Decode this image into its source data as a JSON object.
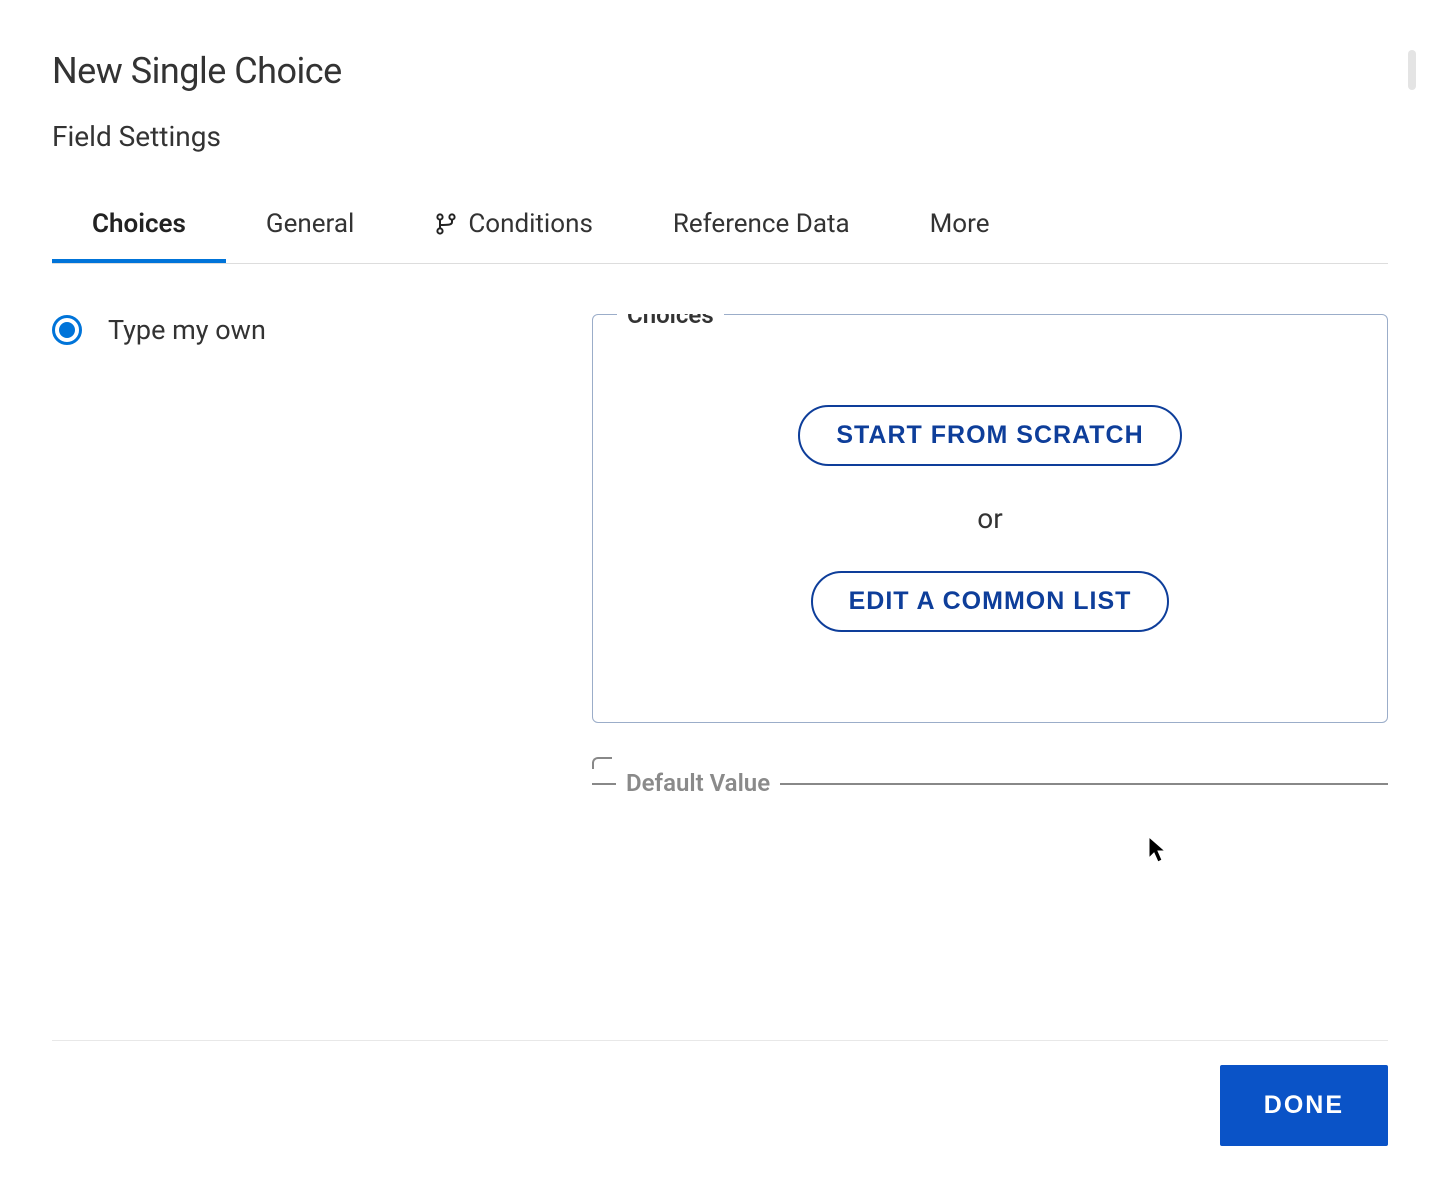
{
  "dialog": {
    "title": "New Single Choice",
    "subtitle": "Field Settings"
  },
  "tabs": [
    {
      "label": "Choices",
      "active": true,
      "hasIcon": false
    },
    {
      "label": "General",
      "active": false,
      "hasIcon": false
    },
    {
      "label": "Conditions",
      "active": false,
      "hasIcon": true,
      "iconName": "branch-icon"
    },
    {
      "label": "Reference Data",
      "active": false,
      "hasIcon": false
    },
    {
      "label": "More",
      "active": false,
      "hasIcon": false
    }
  ],
  "source": {
    "type_my_own_label": "Type my own",
    "selected": true
  },
  "choices_panel": {
    "legend": "Choices",
    "start_from_scratch": "START FROM SCRATCH",
    "or_label": "or",
    "edit_common_list": "EDIT A COMMON LIST"
  },
  "default_value": {
    "legend": "Default Value"
  },
  "footer": {
    "done_label": "DONE"
  },
  "colors": {
    "primary": "#0a53c7",
    "accent": "#0074d9",
    "outline": "#0e3e9a"
  }
}
